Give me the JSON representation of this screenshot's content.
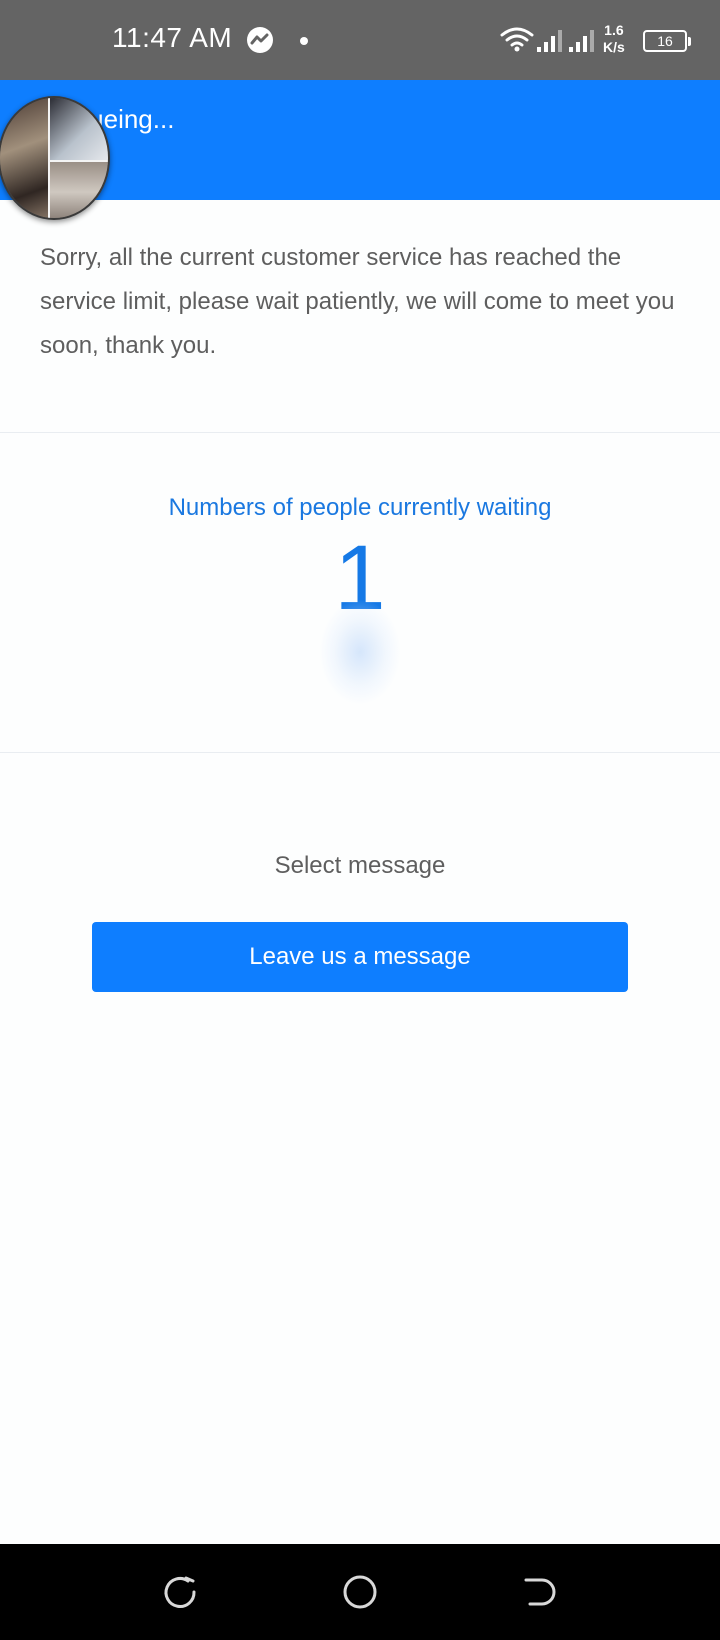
{
  "status_bar": {
    "time": "11:47 AM",
    "net_speed_value": "1.6",
    "net_speed_unit": "K/s",
    "battery": "16",
    "icons": [
      "messenger-icon",
      "wifi-icon",
      "signal-icon",
      "signal-icon",
      "battery-icon"
    ]
  },
  "header": {
    "title": "Queueing...",
    "background": "#0e7eff"
  },
  "notice": {
    "text": "Sorry, all the current customer service has reached the service limit, please wait patiently, we will come to meet you soon, thank you."
  },
  "waiting": {
    "label": "Numbers of people currently waiting",
    "count": "1"
  },
  "actions": {
    "select_label": "Select message",
    "leave_button": "Leave us a message"
  },
  "nav_bar": {
    "icons": [
      "recent-apps-icon",
      "home-icon",
      "back-icon"
    ]
  },
  "colors": {
    "accent": "#0e7eff",
    "status_bar": "#646464",
    "text": "#5e5e5e",
    "link_blue": "#1a78e0"
  }
}
